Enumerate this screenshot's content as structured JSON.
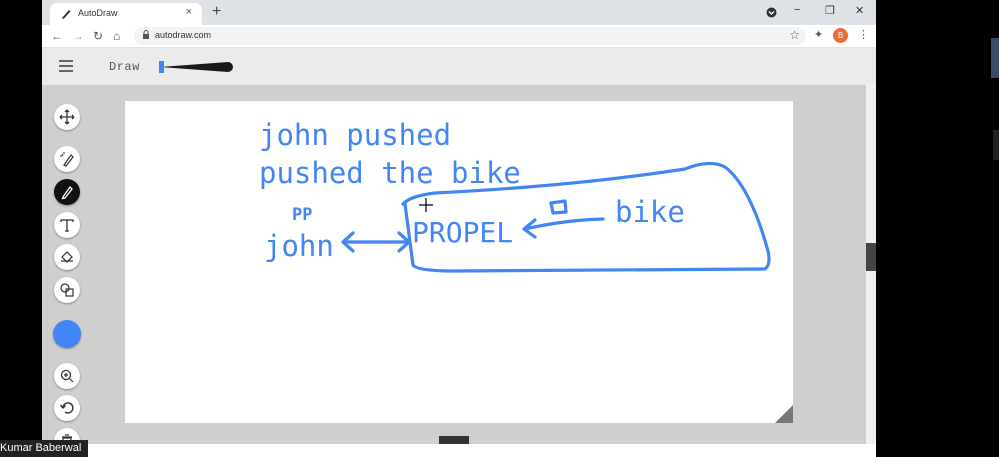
{
  "browser": {
    "tab_title": "AutoDraw",
    "tab_close": "×",
    "new_tab": "+",
    "url": "autodraw.com",
    "avatar_letter": "B",
    "controls": {
      "minimize": "−",
      "maximize": "❐",
      "close": "✕"
    }
  },
  "app": {
    "mode_label": "Draw"
  },
  "canvas_text": {
    "line1": "john pushed",
    "line2": "pushed the bike",
    "pp": "PP",
    "john": "john",
    "propel": "PROPEL",
    "bike": "bike"
  },
  "colors": {
    "ink": "#4285f4",
    "selected_color": "#4285f4"
  },
  "participant_name": "Kumar Baberwal"
}
